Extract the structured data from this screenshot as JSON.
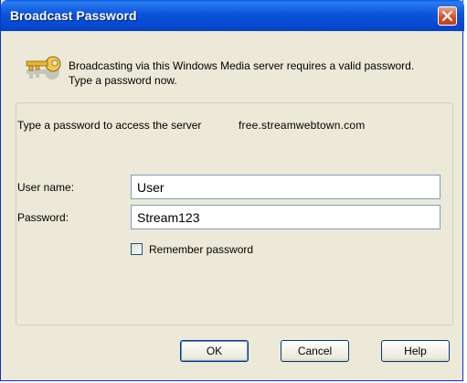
{
  "window": {
    "title": "Broadcast Password"
  },
  "header": {
    "line1": "Broadcasting via this Windows Media server requires a valid password.",
    "line2": "Type a password now."
  },
  "group": {
    "server_label": "Type a password to access the server",
    "server_name": "free.streamwebtown.com"
  },
  "form": {
    "username_label": "User name:",
    "username_value": "User",
    "password_label": "Password:",
    "password_value": "Stream123",
    "remember_label": "Remember password",
    "remember_checked": false
  },
  "buttons": {
    "ok": "OK",
    "cancel": "Cancel",
    "help": "Help"
  },
  "colors": {
    "titlebar": "#0a54db",
    "close": "#d14e26",
    "dialog_bg": "#ece9d8"
  },
  "icons": {
    "header": "key-icon",
    "close": "close-icon"
  }
}
